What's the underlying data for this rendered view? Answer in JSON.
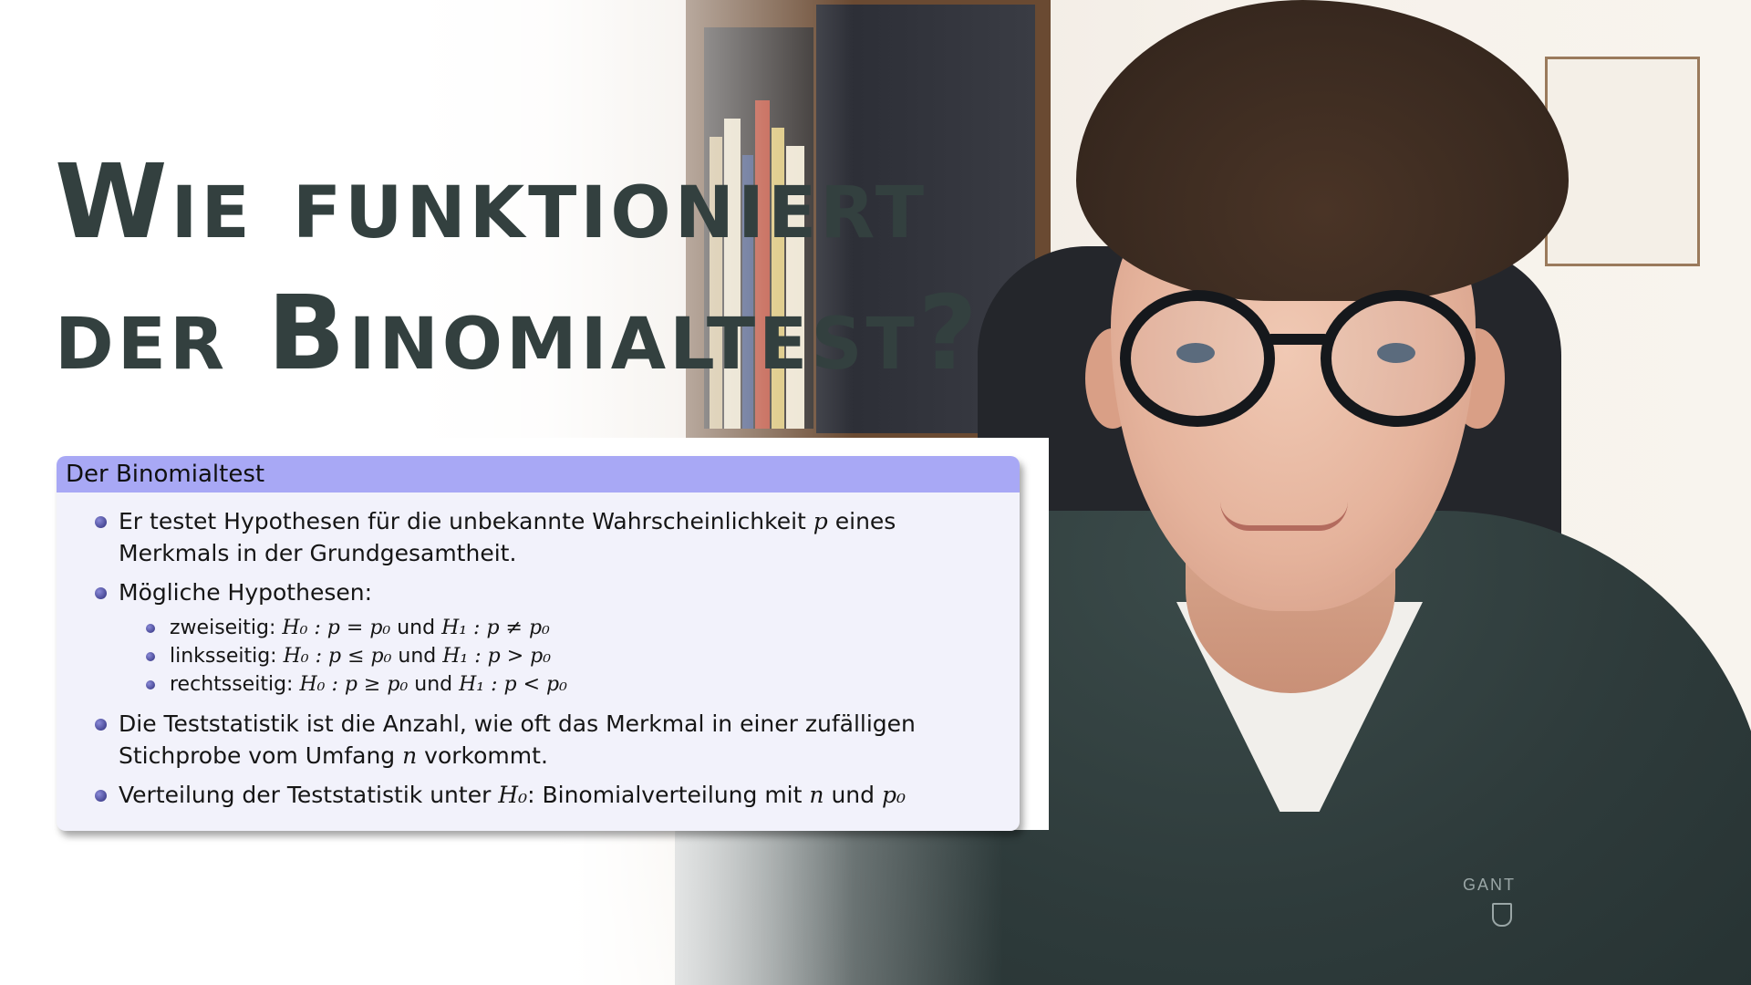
{
  "headline": {
    "line1": "Wie funktioniert",
    "line2": "der Binomialtest?"
  },
  "slide_block": {
    "title": "Der Binomialtest",
    "items": [
      {
        "text_a": "Er testet Hypothesen für die unbekannte Wahrscheinlichkeit ",
        "math": "p",
        "text_b": " eines Merkmals in der Grundgesamtheit."
      },
      {
        "text_a": "Mögliche Hypothesen:"
      },
      {
        "text_a": "Die Teststatistik ist die Anzahl, wie oft das Merkmal in einer zufälligen Stichprobe vom Umfang ",
        "math": "n",
        "text_b": " vorkommt."
      },
      {
        "text_a": "Verteilung der Teststatistik unter ",
        "math": "H₀",
        "text_b": ": Binomialverteilung mit ",
        "math2": "n",
        "text_c": " und ",
        "math3": "p₀"
      }
    ],
    "hypotheses": [
      {
        "label": "zweiseitig: ",
        "h0": "H₀ : p = p₀",
        "joiner": " und ",
        "h1": "H₁ : p ≠ p₀"
      },
      {
        "label": "linksseitig: ",
        "h0": "H₀ : p ≤ p₀",
        "joiner": " und ",
        "h1": "H₁ : p > p₀"
      },
      {
        "label": "rechtsseitig: ",
        "h0": "H₀ : p ≥ p₀",
        "joiner": " und ",
        "h1": "H₁ : p < p₀"
      }
    ]
  },
  "brand_logo": "GANT",
  "colors": {
    "headline": "#33403f",
    "block_title_bg": "#a8a8f5",
    "block_body_bg": "#f2f2fb",
    "bullet": "#2d2d7a"
  }
}
